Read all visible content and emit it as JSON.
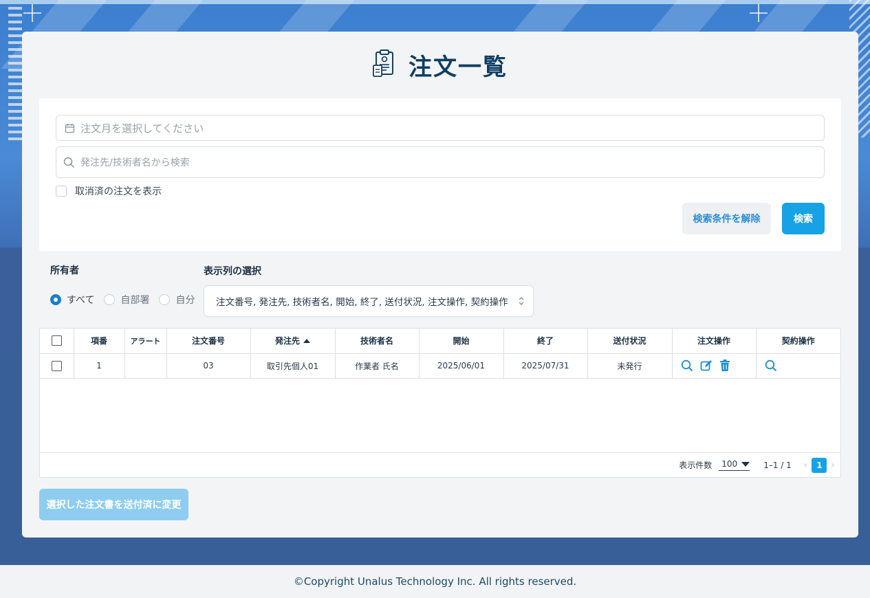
{
  "page": {
    "title": "注文一覧"
  },
  "search": {
    "month_placeholder": "注文月を選択してください",
    "keyword_placeholder": "発注先/技術者名から検索",
    "show_cancelled_label": "取消済の注文を表示",
    "clear_label": "検索条件を解除",
    "search_label": "検索"
  },
  "owner": {
    "label": "所有者",
    "options": [
      {
        "label": "すべて",
        "selected": true
      },
      {
        "label": "自部署",
        "selected": false
      },
      {
        "label": "自分",
        "selected": false
      }
    ]
  },
  "columns": {
    "label": "表示列の選択",
    "selected": "注文番号, 発注先, 技術者名, 開始, 終了, 送付状況, 注文操作, 契約操作"
  },
  "table": {
    "headers": [
      "項番",
      "アラート",
      "注文番号",
      "発注先",
      "技術者名",
      "開始",
      "終了",
      "送付状況",
      "注文操作",
      "契約操作"
    ],
    "rows": [
      {
        "no": "1",
        "alert": "",
        "order_no": "03",
        "vendor": "取引先個人01",
        "engineer": "作業者 氏名",
        "start": "2025/06/01",
        "end": "2025/07/31",
        "status": "未発行"
      }
    ]
  },
  "pagination": {
    "per_page_label": "表示件数",
    "per_page": "100",
    "range": "1–1 / 1",
    "current_page": "1"
  },
  "bulk_action_label": "選択した注文書を送付済に変更",
  "footer": {
    "copyright": "©Copyright Unalus Technology Inc. All rights reserved."
  },
  "colors": {
    "accent": "#17a2e6",
    "title": "#0f3f63",
    "disabled": "#8fcdf0"
  }
}
